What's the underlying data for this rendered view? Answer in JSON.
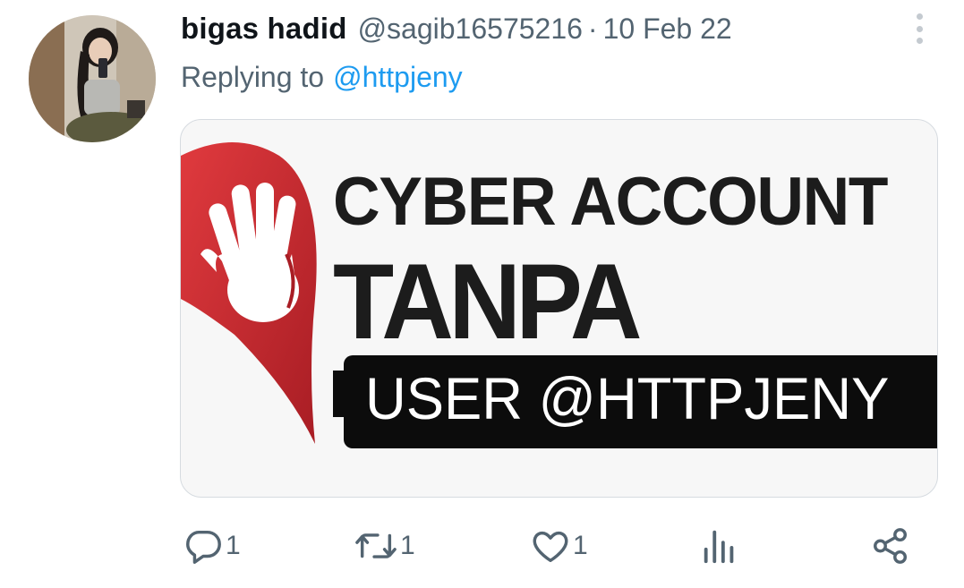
{
  "tweet": {
    "author_name": "bigas hadid",
    "author_handle": "@sagib16575216",
    "separator": "·",
    "date": "10 Feb 22",
    "replying_to_label": "Replying to",
    "replying_to_handle": "@httpjeny",
    "more_icon": "more-vertical-icon"
  },
  "media": {
    "line1": "CYBER ACCOUNT",
    "line2": "TANPA",
    "line3": "USER @HTTPJENY",
    "logo_icon": "stop-hand-icon",
    "accent_color": "#cf2a2f"
  },
  "actions": {
    "reply_count": "1",
    "retweet_count": "1",
    "like_count": "1",
    "icons": [
      "reply-icon",
      "retweet-icon",
      "like-icon",
      "views-icon",
      "share-icon"
    ],
    "icon_color": "#536471"
  }
}
